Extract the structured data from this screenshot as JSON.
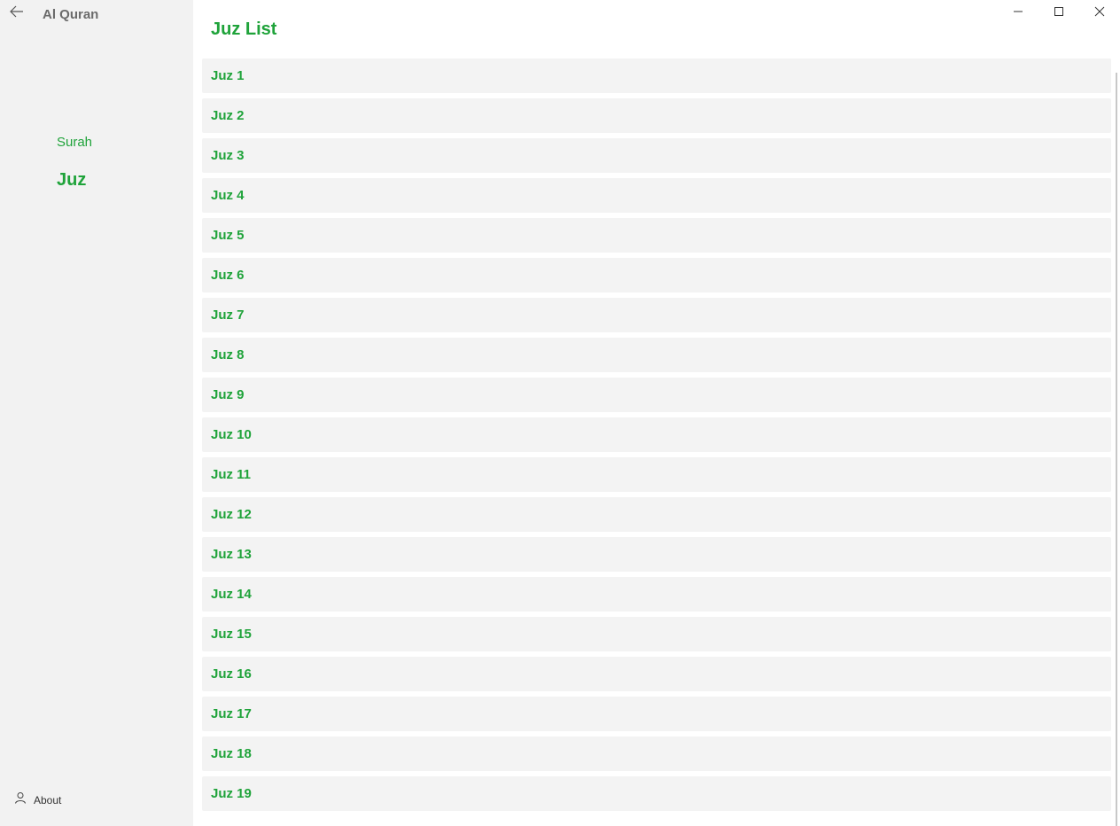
{
  "app": {
    "title": "Al Quran"
  },
  "sidebar": {
    "back_icon": "arrow-left-icon",
    "items": [
      {
        "label": "Surah",
        "selected": false
      },
      {
        "label": "Juz",
        "selected": true
      }
    ],
    "footer": {
      "icon": "person-icon",
      "label": "About"
    }
  },
  "window_controls": {
    "minimize_icon": "minimize-icon",
    "maximize_icon": "maximize-icon",
    "close_icon": "close-icon"
  },
  "main": {
    "title": "Juz List",
    "items": [
      {
        "label": "Juz 1"
      },
      {
        "label": "Juz 2"
      },
      {
        "label": "Juz 3"
      },
      {
        "label": "Juz 4"
      },
      {
        "label": "Juz 5"
      },
      {
        "label": "Juz 6"
      },
      {
        "label": "Juz 7"
      },
      {
        "label": "Juz 8"
      },
      {
        "label": "Juz 9"
      },
      {
        "label": "Juz 10"
      },
      {
        "label": "Juz 11"
      },
      {
        "label": "Juz 12"
      },
      {
        "label": "Juz 13"
      },
      {
        "label": "Juz 14"
      },
      {
        "label": "Juz 15"
      },
      {
        "label": "Juz 16"
      },
      {
        "label": "Juz 17"
      },
      {
        "label": "Juz 18"
      },
      {
        "label": "Juz 19"
      }
    ]
  },
  "colors": {
    "accent": "#1fa33a",
    "sidebar_bg": "#f2f2f2",
    "item_bg": "#f3f3f3"
  }
}
